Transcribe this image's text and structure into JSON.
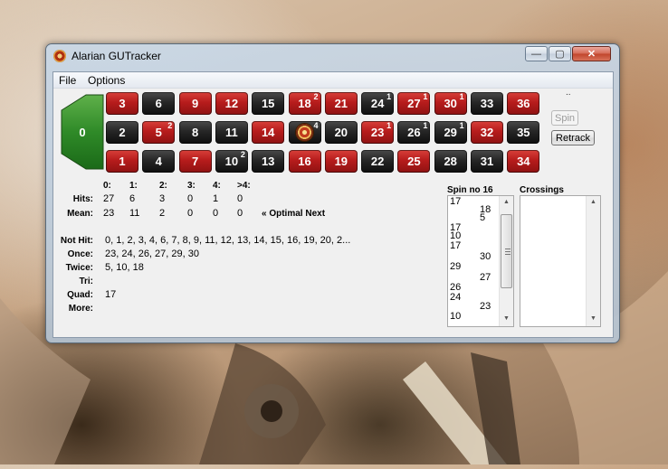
{
  "window": {
    "title": "Alarian GUTracker",
    "minimize_label": "—",
    "maximize_label": "▢",
    "close_label": "✕"
  },
  "menu": {
    "items": [
      "File",
      "Options"
    ]
  },
  "table": {
    "zero": {
      "label": "0"
    },
    "rows": [
      [
        {
          "n": "3",
          "color": "red"
        },
        {
          "n": "6",
          "color": "black"
        },
        {
          "n": "9",
          "color": "red"
        },
        {
          "n": "12",
          "color": "red"
        },
        {
          "n": "15",
          "color": "black"
        },
        {
          "n": "18",
          "color": "red",
          "hits": "2"
        },
        {
          "n": "21",
          "color": "red"
        },
        {
          "n": "24",
          "color": "black",
          "hits": "1"
        },
        {
          "n": "27",
          "color": "red",
          "hits": "1"
        },
        {
          "n": "30",
          "color": "red",
          "hits": "1"
        },
        {
          "n": "33",
          "color": "black"
        },
        {
          "n": "36",
          "color": "red"
        }
      ],
      [
        {
          "n": "2",
          "color": "black"
        },
        {
          "n": "5",
          "color": "red",
          "hits": "2"
        },
        {
          "n": "8",
          "color": "black"
        },
        {
          "n": "11",
          "color": "black"
        },
        {
          "n": "14",
          "color": "red"
        },
        {
          "n": "",
          "color": "wheel",
          "hits": "4",
          "icon": "roulette-wheel-icon"
        },
        {
          "n": "20",
          "color": "black"
        },
        {
          "n": "23",
          "color": "red",
          "hits": "1"
        },
        {
          "n": "26",
          "color": "black",
          "hits": "1"
        },
        {
          "n": "29",
          "color": "black",
          "hits": "1"
        },
        {
          "n": "32",
          "color": "red"
        },
        {
          "n": "35",
          "color": "black"
        }
      ],
      [
        {
          "n": "1",
          "color": "red"
        },
        {
          "n": "4",
          "color": "black"
        },
        {
          "n": "7",
          "color": "red"
        },
        {
          "n": "10",
          "color": "black",
          "hits": "2"
        },
        {
          "n": "13",
          "color": "black"
        },
        {
          "n": "16",
          "color": "red"
        },
        {
          "n": "19",
          "color": "red"
        },
        {
          "n": "22",
          "color": "black"
        },
        {
          "n": "25",
          "color": "red"
        },
        {
          "n": "28",
          "color": "black"
        },
        {
          "n": "31",
          "color": "black"
        },
        {
          "n": "34",
          "color": "red"
        }
      ]
    ]
  },
  "status_dots": "..",
  "buttons": {
    "spin": "Spin",
    "retrack": "Retrack"
  },
  "stats": {
    "headers": [
      "0:",
      "1:",
      "2:",
      "3:",
      "4:",
      ">4:"
    ],
    "hits_label": "Hits:",
    "hits": [
      "27",
      "6",
      "3",
      "0",
      "1",
      "0"
    ],
    "mean_label": "Mean:",
    "mean": [
      "23",
      "11",
      "2",
      "0",
      "0",
      "0"
    ],
    "optimal_label": "« Optimal Next"
  },
  "lists": [
    {
      "label": "Not Hit:",
      "value": "0, 1, 2, 3, 4, 6, 7, 8, 9, 11, 12, 13, 14, 15, 16, 19, 20, 2..."
    },
    {
      "label": "Once:",
      "value": "23, 24, 26, 27, 29, 30"
    },
    {
      "label": "Twice:",
      "value": "5, 10, 18"
    },
    {
      "label": "Tri:",
      "value": ""
    },
    {
      "label": "Quad:",
      "value": "17"
    },
    {
      "label": "More:",
      "value": ""
    }
  ],
  "spin_history": {
    "title": "Spin no 16",
    "entries": [
      {
        "v": "17",
        "col": "left"
      },
      {
        "v": "18",
        "col": "right"
      },
      {
        "v": "5",
        "col": "right"
      },
      {
        "v": "17",
        "col": "left"
      },
      {
        "v": "10",
        "col": "left"
      },
      {
        "v": "17",
        "col": "left"
      },
      {
        "v": "30",
        "col": "right"
      },
      {
        "v": "29",
        "col": "left"
      },
      {
        "v": "27",
        "col": "right"
      },
      {
        "v": "26",
        "col": "left"
      },
      {
        "v": "24",
        "col": "left"
      },
      {
        "v": "23",
        "col": "right"
      },
      {
        "v": "10",
        "col": "left"
      }
    ]
  },
  "crossings": {
    "title": "Crossings"
  }
}
